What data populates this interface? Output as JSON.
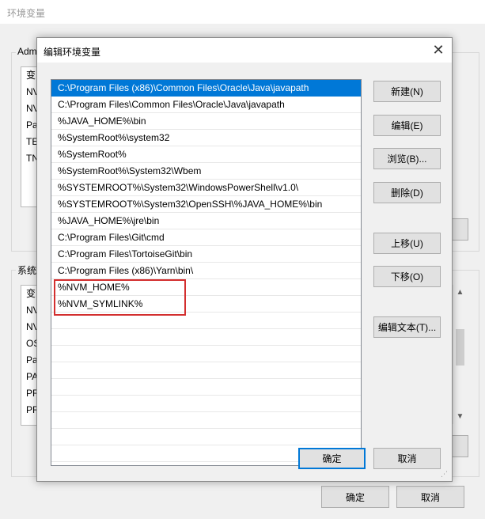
{
  "background_window": {
    "title": "环境变量",
    "user_group_label": "Adm",
    "user_list_items": [
      "变",
      "NV",
      "NV",
      "Pa",
      "TE",
      "TN"
    ],
    "system_group_label": "系统",
    "system_list_items": [
      "变",
      "NV",
      "NV",
      "OS",
      "Pa",
      "PA",
      "PR",
      "PR"
    ],
    "ok_label": "确定",
    "cancel_label": "取消"
  },
  "dialog": {
    "title": "编辑环境变量",
    "paths": [
      "C:\\Program Files (x86)\\Common Files\\Oracle\\Java\\javapath",
      "C:\\Program Files\\Common Files\\Oracle\\Java\\javapath",
      "%JAVA_HOME%\\bin",
      "%SystemRoot%\\system32",
      "%SystemRoot%",
      "%SystemRoot%\\System32\\Wbem",
      "%SYSTEMROOT%\\System32\\WindowsPowerShell\\v1.0\\",
      "%SYSTEMROOT%\\System32\\OpenSSH\\%JAVA_HOME%\\bin",
      "%JAVA_HOME%\\jre\\bin",
      "C:\\Program Files\\Git\\cmd",
      "C:\\Program Files\\TortoiseGit\\bin",
      "C:\\Program Files (x86)\\Yarn\\bin\\",
      "%NVM_HOME%",
      "%NVM_SYMLINK%"
    ],
    "selected_index": 0,
    "buttons": {
      "new": "新建(N)",
      "edit": "编辑(E)",
      "browse": "浏览(B)...",
      "delete": "删除(D)",
      "move_up": "上移(U)",
      "move_down": "下移(O)",
      "edit_text": "编辑文本(T)..."
    },
    "ok_label": "确定",
    "cancel_label": "取消"
  },
  "colors": {
    "selection": "#0078d7",
    "highlight_box": "#d32f2f"
  },
  "icons": {
    "close": "close-icon",
    "scroll_up": "scroll-up-arrow-icon",
    "scroll_down": "scroll-down-arrow-icon"
  }
}
